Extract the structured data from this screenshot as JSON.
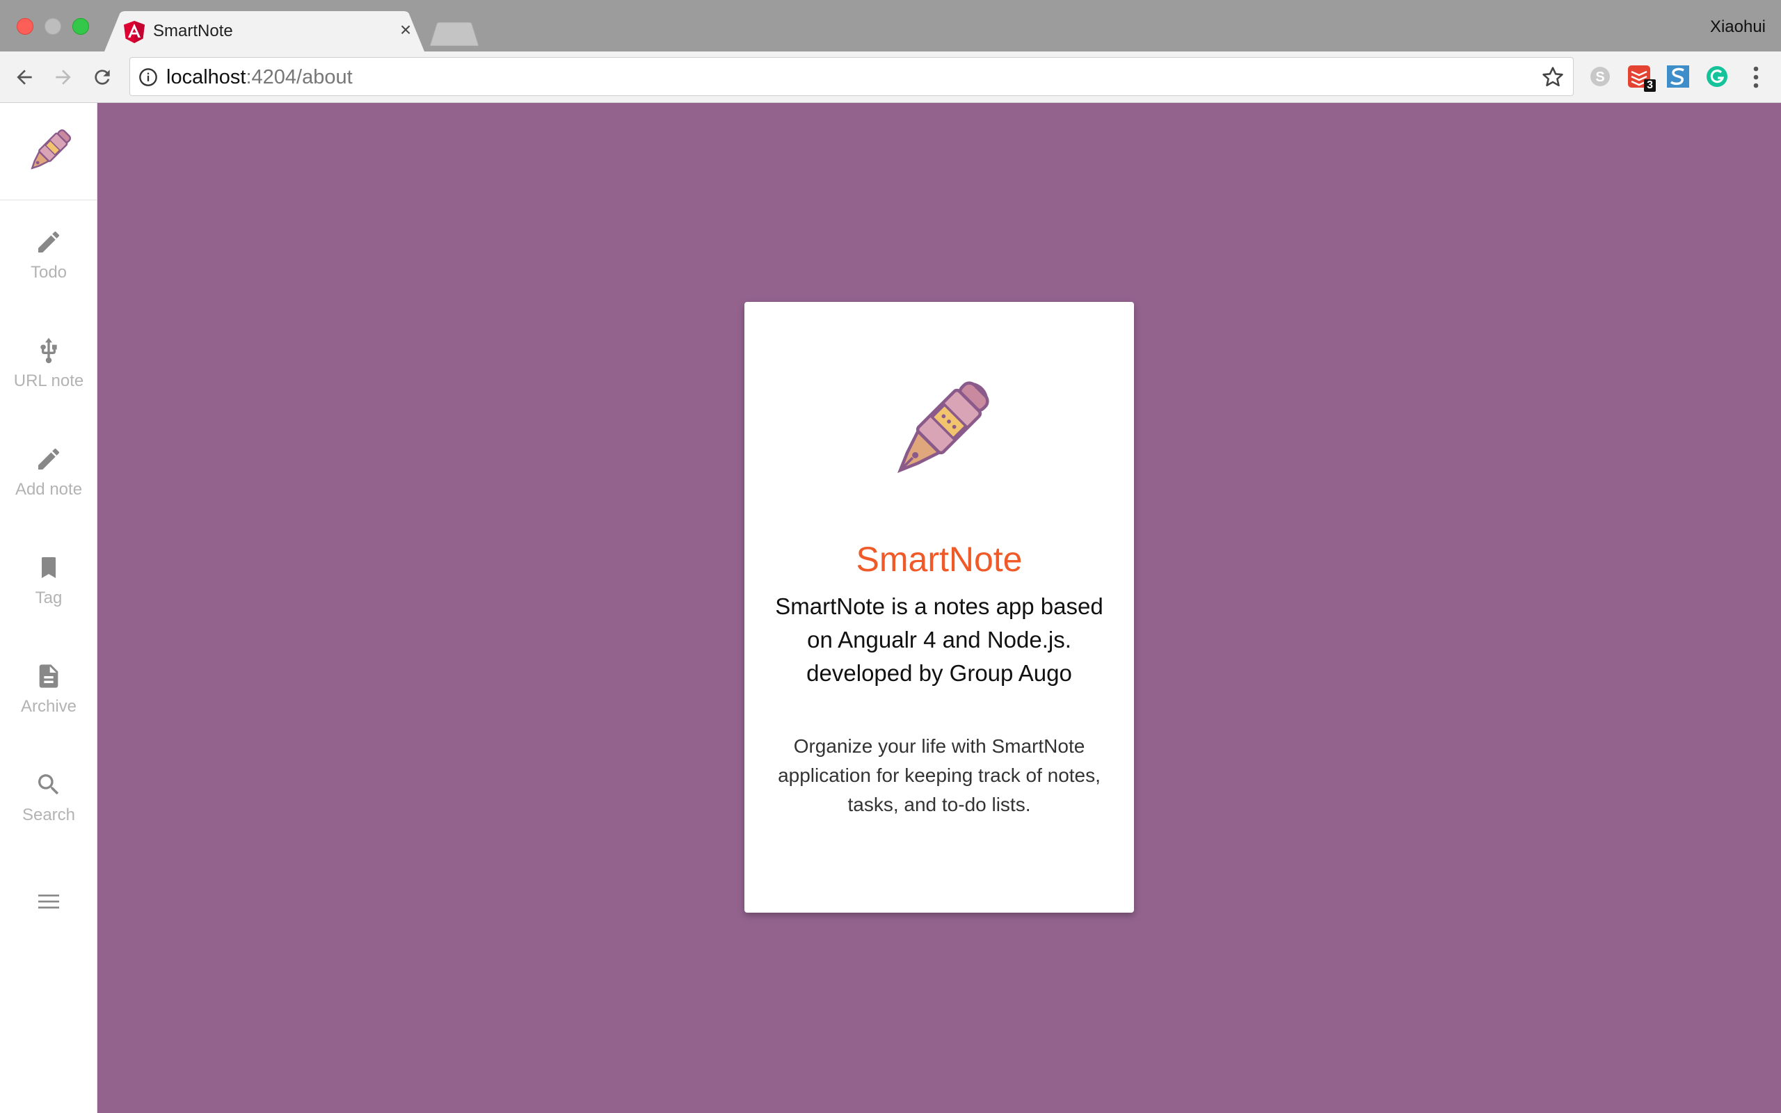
{
  "browser": {
    "tab_title": "SmartNote",
    "tab_close_symbol": "×",
    "profile_name": "Xiaohui",
    "url_host": "localhost",
    "url_rest": ":4204/about",
    "extension_badge": "3"
  },
  "sidebar": {
    "items": [
      {
        "label": "Todo",
        "icon": "pencil-icon"
      },
      {
        "label": "URL note",
        "icon": "usb-icon"
      },
      {
        "label": "Add note",
        "icon": "pencil-icon"
      },
      {
        "label": "Tag",
        "icon": "bookmark-icon"
      },
      {
        "label": "Archive",
        "icon": "document-icon"
      },
      {
        "label": "Search",
        "icon": "search-icon"
      }
    ],
    "menu_icon": "hamburger-icon"
  },
  "card": {
    "title": "SmartNote",
    "description_lines": [
      "SmartNote is a notes app based",
      "on Angualr 4 and Node.js.",
      "developed by Group Augo"
    ],
    "tagline_lines": [
      "Organize your life with SmartNote",
      "application for keeping track of notes,",
      "tasks, and to-do lists."
    ]
  },
  "colors": {
    "main_background": "#93638e",
    "title_color": "#f05a28",
    "sidebar_label": "#b3b3b3"
  }
}
